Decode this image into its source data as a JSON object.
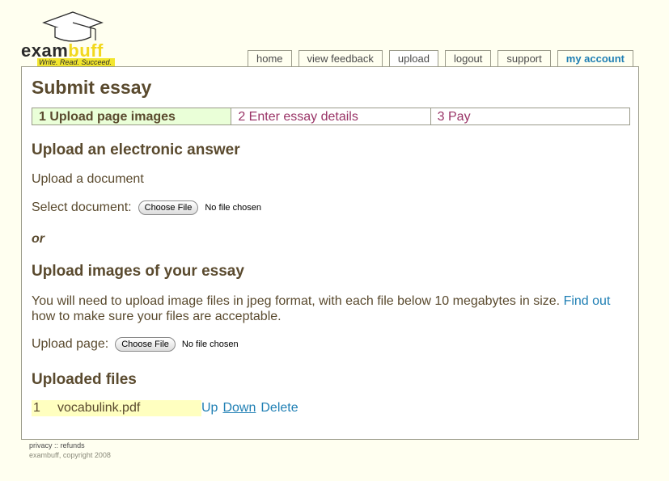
{
  "brand": {
    "word_a": "exam",
    "word_b": "buff",
    "tagline": "Write. Read. Succeed."
  },
  "tabs": [
    {
      "label": "home"
    },
    {
      "label": "view feedback"
    },
    {
      "label": "upload"
    },
    {
      "label": "logout"
    },
    {
      "label": "support"
    },
    {
      "label": "my account"
    }
  ],
  "page": {
    "title": "Submit essay",
    "steps": [
      "1 Upload page images",
      "2 Enter essay details",
      "3 Pay"
    ]
  },
  "electronic": {
    "heading": "Upload an electronic answer",
    "subheading": "Upload a document",
    "select_label": "Select document:",
    "button": "Choose File",
    "status": "No file chosen"
  },
  "or_label": "or",
  "images": {
    "heading": "Upload images of your essay",
    "description": "You will need to upload image files in jpeg format, with each file below 10 megabytes in size.",
    "find_out_link": "Find out",
    "description_tail": "how to make sure your files are acceptable.",
    "page_label": "Upload page:",
    "button": "Choose File",
    "status": "No file chosen"
  },
  "uploaded": {
    "heading": "Uploaded files",
    "files": [
      {
        "num": "1",
        "name": "vocabulink.pdf",
        "actions": {
          "up": "Up",
          "down": "Down",
          "delete": "Delete"
        }
      }
    ]
  },
  "footer": {
    "privacy": "privacy",
    "sep": "::",
    "refunds": "refunds",
    "copyright": "exambuff, copyright 2008"
  },
  "colors": {
    "accent": "#1f7fb4",
    "heading": "#5a4a2e",
    "step_link": "#993366",
    "brand_yellow": "#f2d81e"
  }
}
